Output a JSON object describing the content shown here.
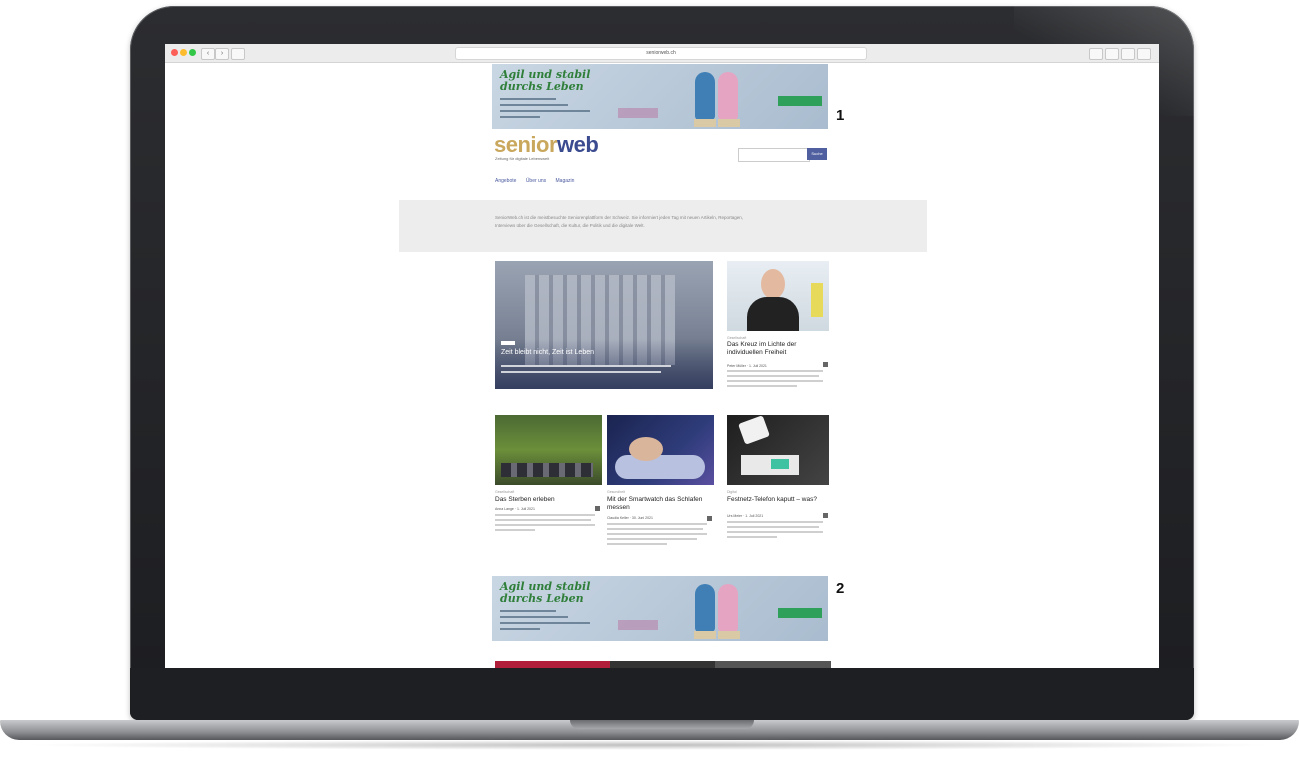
{
  "browser": {
    "url": "seniorweb.ch",
    "back_glyph": "‹",
    "forward_glyph": "›"
  },
  "ads": [
    {
      "headline": "Agil und stabil durchs Leben",
      "number": "1"
    },
    {
      "headline": "Agil und stabil durchs Leben",
      "number": "2"
    }
  ],
  "logo": {
    "part1": "senior",
    "part2": "web",
    "tagline": "Zeitung für digitale Lebenswelt"
  },
  "search": {
    "placeholder": "",
    "button": "Suche"
  },
  "nav": [
    "Angebote",
    "Über uns",
    "Magazin"
  ],
  "intro": {
    "text": "SeniorWeb.ch ist die meistbesuchte Seniorenplattform der Schweiz. Sie informiert jeden Tag mit neuen Artikeln, Reportagen, Interviews über die Gesellschaft, die Kultur, die Politik und die digitale Welt."
  },
  "hero": {
    "badge": "",
    "title": "Zeit bleibt nicht, Zeit ist Leben"
  },
  "cards": [
    {
      "category": "Gesellschaft",
      "title": "Das Kreuz im Lichte der individuellen Freiheit",
      "meta": "Peter Müller · 1. Juli 2021"
    },
    {
      "category": "Gesellschaft",
      "title": "Das Sterben erleben",
      "meta": "Anna Lange · 1. Juli 2021"
    },
    {
      "category": "Gesundheit",
      "title": "Mit der Smartwatch das Schlafen messen",
      "meta": "Claudia Keller · 30. Juni 2021"
    },
    {
      "category": "Digital",
      "title": "Festnetz-Telefon kaputt – was?",
      "meta": "Urs Meier · 1. Juli 2021"
    }
  ],
  "colors": {
    "accent": "#4f5fa0",
    "logo_gold": "#c9a85e",
    "logo_blue": "#3b4b8f",
    "ad_green": "#2fa05a"
  }
}
